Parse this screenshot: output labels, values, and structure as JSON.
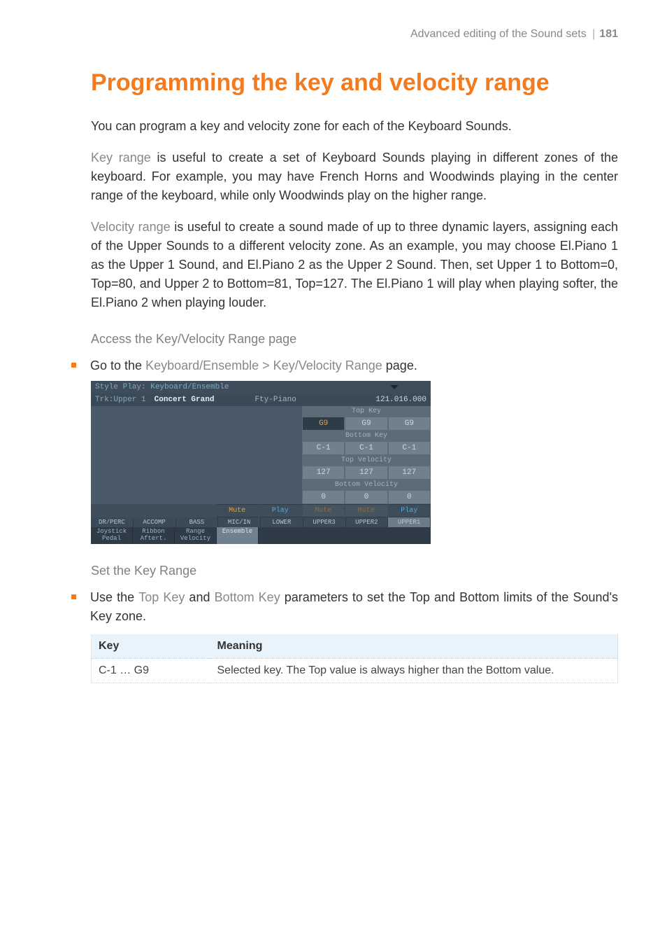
{
  "header": {
    "section": "Advanced editing of the Sound sets",
    "separator": "|",
    "page": "181"
  },
  "title": "Programming the key and velocity range",
  "para_intro": "You can program a key and velocity zone for each of the Keyboard Sounds.",
  "para_key_lead": "Key range",
  "para_key_body": " is useful to create a set of Keyboard Sounds playing in different zones of the keyboard. For example, you may have French Horns and Woodwinds playing in the center range of the keyboard, while only Woodwinds play on the higher range.",
  "para_vel_lead": "Velocity range",
  "para_vel_body": " is useful to create a sound made of up to three dynamic layers, assigning each of the Upper Sounds to a different velocity zone. As an example, you may choose El.Piano 1 as the Upper 1 Sound, and El.Piano 2 as the Upper 2 Sound. Then, set Upper 1 to Bottom=0, Top=80, and Upper 2 to Bottom=81, Top=127. The El.Piano 1 will play when playing softer, the El.Piano 2 when playing louder.",
  "sub_access": "Access the Key/Velocity Range page",
  "bullet_access_pre": "Go to the ",
  "bullet_access_strong": "Keyboard/Ensemble > Key/Velocity Range",
  "bullet_access_post": " page.",
  "sub_set": "Set the Key Range",
  "bullet_set_pre": "Use the ",
  "bullet_set_s1": "Top Key",
  "bullet_set_mid": " and ",
  "bullet_set_s2": "Bottom Key",
  "bullet_set_post": " parameters to set the Top and Bottom limits of the Sound's Key zone.",
  "table": {
    "head_key": "Key",
    "head_meaning": "Meaning",
    "row_key": "C-1 … G9",
    "row_meaning": "Selected key. The Top value is always higher than the Bottom value."
  },
  "screen": {
    "title": "Style Play: Keyboard/Ensemble",
    "trk_label": "Trk:Upper 1",
    "trk_name": "Concert Grand",
    "trk_mid": "Fty-Piano",
    "trk_num": "121.016.000",
    "params": [
      {
        "name": "Top Key",
        "values": [
          "G9",
          "G9",
          "G9"
        ],
        "selected": 0
      },
      {
        "name": "Bottom Key",
        "values": [
          "C-1",
          "C-1",
          "C-1"
        ],
        "selected": -1
      },
      {
        "name": "Top Velocity",
        "values": [
          "127",
          "127",
          "127"
        ],
        "selected": -1
      },
      {
        "name": "Bottom Velocity",
        "values": [
          "0",
          "0",
          "0"
        ],
        "selected": -1
      }
    ],
    "muteplay": [
      "",
      "",
      "",
      "Mute",
      "Play",
      "Mute",
      "Mute",
      "Play"
    ],
    "muteplay_kind": [
      "",
      "",
      "",
      "mute",
      "play",
      "dim",
      "dim",
      "play"
    ],
    "tracks": [
      "DR/PERC",
      "ACCOMP",
      "BASS",
      "MIC/IN",
      "LOWER",
      "UPPER3",
      "UPPER2",
      "UPPER1"
    ],
    "tabs": [
      "Joystick\nPedal",
      "Ribbon\nAftert.",
      "Range\nVelocity",
      "Ensemble"
    ],
    "tab_selected": 3
  }
}
